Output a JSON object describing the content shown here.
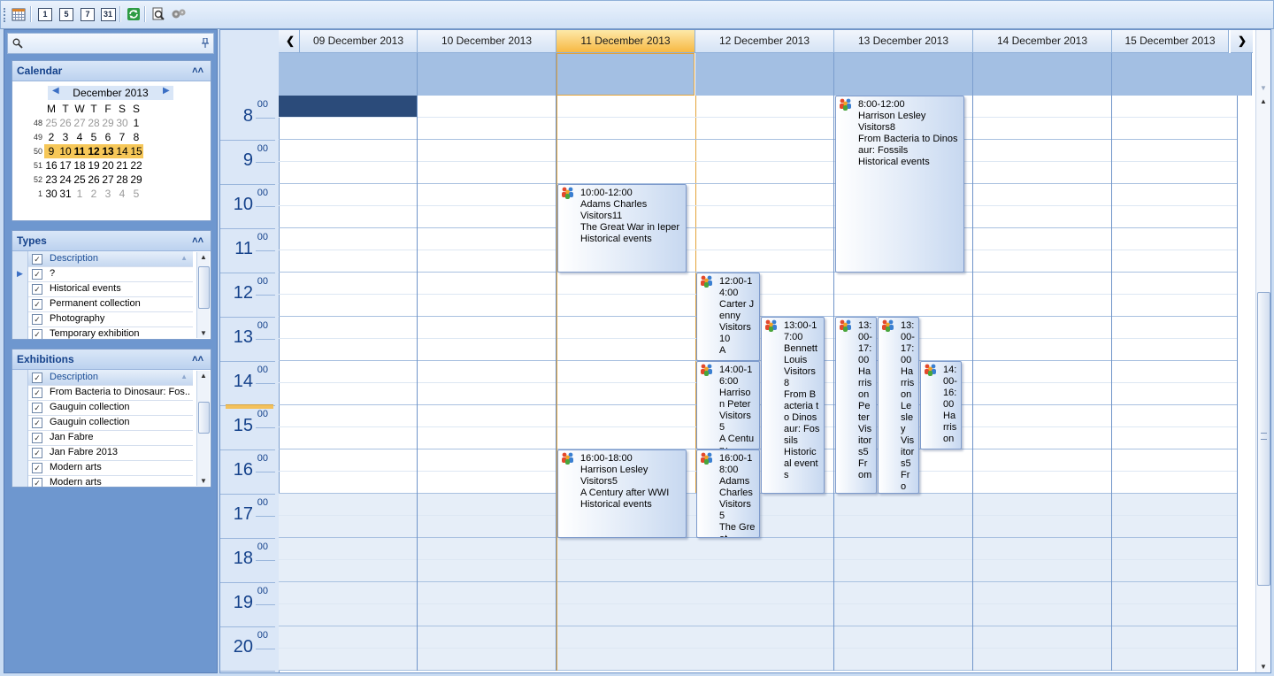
{
  "toolbar": {
    "buttons": [
      {
        "name": "month-view-button",
        "label": ""
      },
      {
        "name": "day-view-button",
        "label": "1"
      },
      {
        "name": "workweek-view-button",
        "label": "5"
      },
      {
        "name": "week-view-button",
        "label": "7"
      },
      {
        "name": "month31-view-button",
        "label": "31"
      },
      {
        "name": "refresh-button",
        "label": ""
      },
      {
        "name": "print-preview-button",
        "label": ""
      },
      {
        "name": "settings-button",
        "label": ""
      }
    ]
  },
  "leftpane": {
    "calendar_panel": {
      "title": "Calendar",
      "month_title": "December 2013",
      "weekdays": [
        "M",
        "T",
        "W",
        "T",
        "F",
        "S",
        "S"
      ],
      "weeks": [
        {
          "wk": "48",
          "days": [
            "25",
            "26",
            "27",
            "28",
            "29",
            "30",
            "1"
          ]
        },
        {
          "wk": "49",
          "days": [
            "2",
            "3",
            "4",
            "5",
            "6",
            "7",
            "8"
          ]
        },
        {
          "wk": "50",
          "days": [
            "9",
            "10",
            "11",
            "12",
            "13",
            "14",
            "15"
          ]
        },
        {
          "wk": "51",
          "days": [
            "16",
            "17",
            "18",
            "19",
            "20",
            "21",
            "22"
          ]
        },
        {
          "wk": "52",
          "days": [
            "23",
            "24",
            "25",
            "26",
            "27",
            "28",
            "29"
          ]
        },
        {
          "wk": "1",
          "days": [
            "30",
            "31",
            "1",
            "2",
            "3",
            "4",
            "5"
          ]
        }
      ]
    },
    "types_panel": {
      "title": "Types",
      "header": "Description",
      "rows": [
        "?",
        "Historical events",
        "Permanent collection",
        "Photography",
        "Temporary exhibition"
      ]
    },
    "exhibitions_panel": {
      "title": "Exhibitions",
      "header": "Description",
      "rows": [
        "From Bacteria to Dinosaur: Fos...",
        "Gauguin collection",
        "Gauguin collection",
        "Jan Fabre",
        "Jan Fabre 2013",
        "Modern arts",
        "Modern arts"
      ]
    }
  },
  "scheduler": {
    "days": [
      "09 December 2013",
      "10 December 2013",
      "11 December 2013",
      "12 December 2013",
      "13 December 2013",
      "14 December 2013",
      "15 December 2013"
    ],
    "today_index": 2,
    "hours": [
      "8",
      "9",
      "10",
      "11",
      "12",
      "13",
      "14",
      "15",
      "16",
      "17",
      "18",
      "19",
      "20"
    ],
    "minutes_label": "00",
    "appointments": [
      {
        "day": 2,
        "start": 10,
        "end": 12,
        "lane": 0,
        "lanes": 1,
        "lines": [
          "10:00-12:00",
          "Adams Charles",
          "Visitors11",
          "The Great War in Ieper",
          "Historical events"
        ]
      },
      {
        "day": 2,
        "start": 16,
        "end": 18,
        "lane": 0,
        "lanes": 1,
        "lines": [
          "16:00-18:00",
          "Harrison Lesley",
          "Visitors5",
          "A Century after WWI",
          "Historical events"
        ]
      },
      {
        "day": 3,
        "start": 12,
        "end": 14,
        "lane": 0,
        "lanes": 2,
        "lines": [
          "12:00-14:00",
          "Carter Jenny",
          "Visitors10",
          "A"
        ]
      },
      {
        "day": 3,
        "start": 14,
        "end": 16,
        "lane": 0,
        "lanes": 2,
        "lines": [
          "14:00-16:00",
          "Harrison Peter",
          "Visitors5",
          "A Century"
        ]
      },
      {
        "day": 3,
        "start": 16,
        "end": 18,
        "lane": 0,
        "lanes": 2,
        "lines": [
          "16:00-18:00",
          "Adams Charles",
          "Visitors5",
          "The Great"
        ]
      },
      {
        "day": 3,
        "start": 13,
        "end": 17,
        "lane": 1,
        "lanes": 2,
        "lines": [
          "13:00-17:00",
          "Bennett Louis",
          "Visitors8",
          "From Bacteria to Dinosaur: Fossils",
          "Historical events"
        ]
      },
      {
        "day": 4,
        "start": 8,
        "end": 12,
        "lane": 0,
        "lanes": 1,
        "lines": [
          "8:00-12:00",
          "Harrison Lesley",
          "Visitors8",
          "From Bacteria to Dinosaur: Fossils",
          "Historical events"
        ]
      },
      {
        "day": 4,
        "start": 13,
        "end": 17,
        "lane": 0,
        "lanes": 3,
        "lines": [
          "13:00-17:00",
          "Harrison Peter",
          "Visitors5",
          "From"
        ]
      },
      {
        "day": 4,
        "start": 13,
        "end": 17,
        "lane": 1,
        "lanes": 3,
        "lines": [
          "13:00-17:00",
          "Harrison Lesley",
          "Visitors5",
          "Fro"
        ]
      },
      {
        "day": 4,
        "start": 14,
        "end": 16,
        "lane": 2,
        "lanes": 3,
        "lines": [
          "14:00-16:00",
          "Harrison"
        ]
      }
    ]
  },
  "colors": {
    "today_header": "#f7b843",
    "selected_cell": "#2b4b7a",
    "hour_text": "#15428b"
  }
}
